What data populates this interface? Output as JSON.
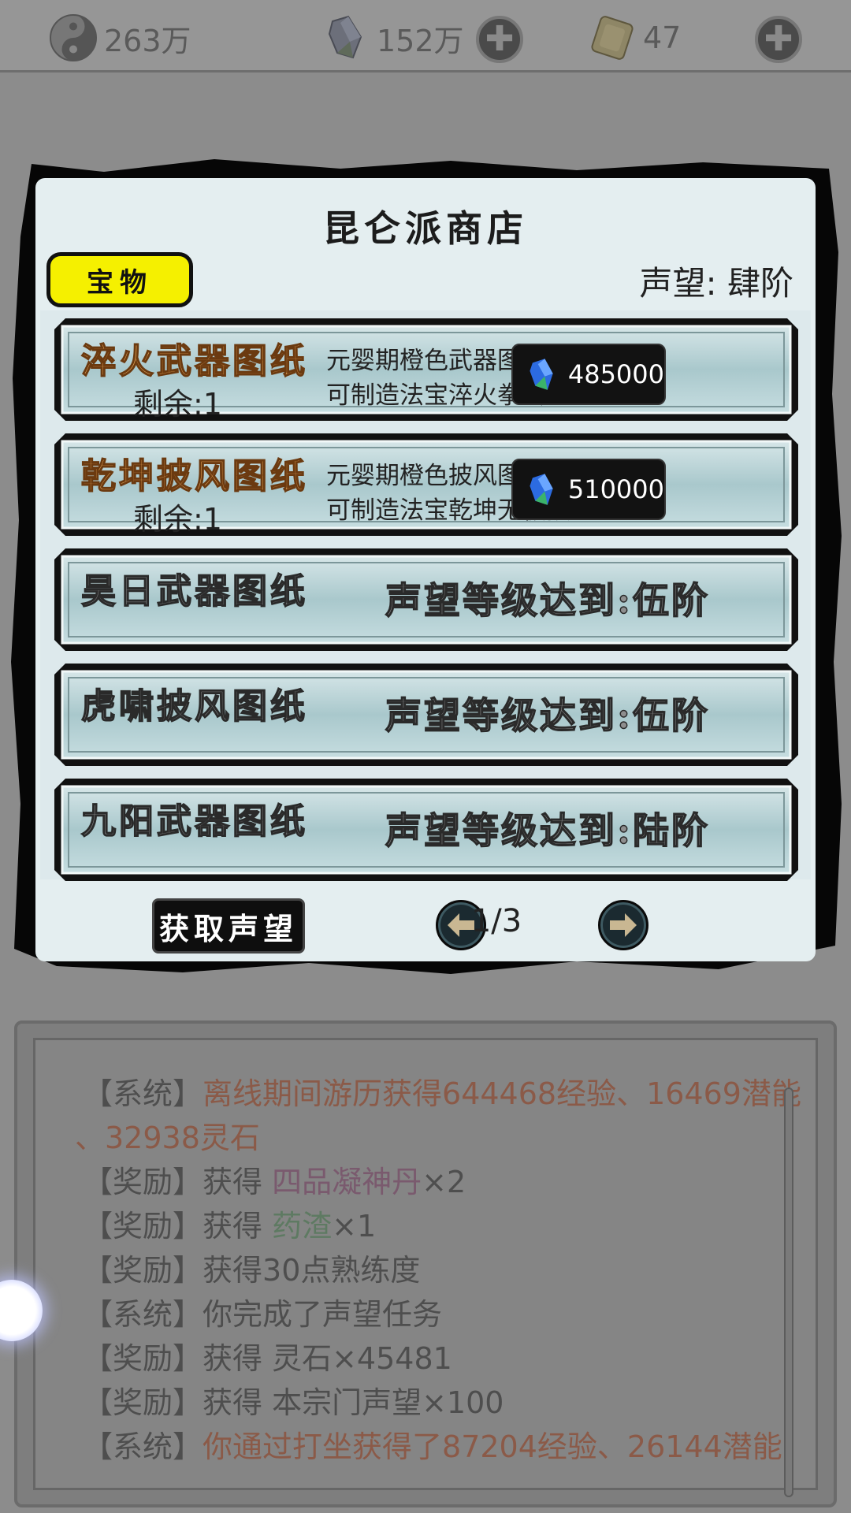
{
  "currency": {
    "spirit": "263万",
    "gem": "152万",
    "token": "47"
  },
  "shop": {
    "title": "昆仑派商店",
    "tab_label": "宝物",
    "reputation": "声望: 肆阶",
    "items": [
      {
        "name": "淬火武器图纸",
        "remain": "剩余:1",
        "desc1": "元婴期橙色武器图纸，",
        "desc2": "可制造法宝淬火拳套。",
        "price": "485000"
      },
      {
        "name": "乾坤披风图纸",
        "remain": "剩余:1",
        "desc1": "元婴期橙色披风图纸，",
        "desc2": "可制造法宝乾坤无极披",
        "price": "510000"
      },
      {
        "name": "昊日武器图纸",
        "requirement": "声望等级达到:伍阶"
      },
      {
        "name": "虎啸披风图纸",
        "requirement": "声望等级达到:伍阶"
      },
      {
        "name": "九阳武器图纸",
        "requirement": "声望等级达到:陆阶"
      }
    ],
    "get_reputation": "获取声望",
    "page": "1/3"
  },
  "log": {
    "lines": [
      {
        "tag": "【系统】",
        "text": "离线期间游历获得644468经验、16469潜能"
      },
      {
        "tag": "",
        "text": "、32938灵石"
      },
      {
        "tag": "【奖励】",
        "pre": "获得 ",
        "item": "四品凝神丹",
        "post": "×2"
      },
      {
        "tag": "【奖励】",
        "pre": "获得 ",
        "item": "药渣",
        "post": "×1"
      },
      {
        "tag": "【奖励】",
        "text": "获得30点熟练度"
      },
      {
        "tag": "【系统】",
        "text": "你完成了声望任务"
      },
      {
        "tag": "【奖励】",
        "text": "获得 灵石×45481"
      },
      {
        "tag": "【奖励】",
        "text": "获得 本宗门声望×100"
      },
      {
        "tag": "【系统】",
        "text": "你通过打坐获得了87204经验、26144潜能"
      }
    ]
  }
}
